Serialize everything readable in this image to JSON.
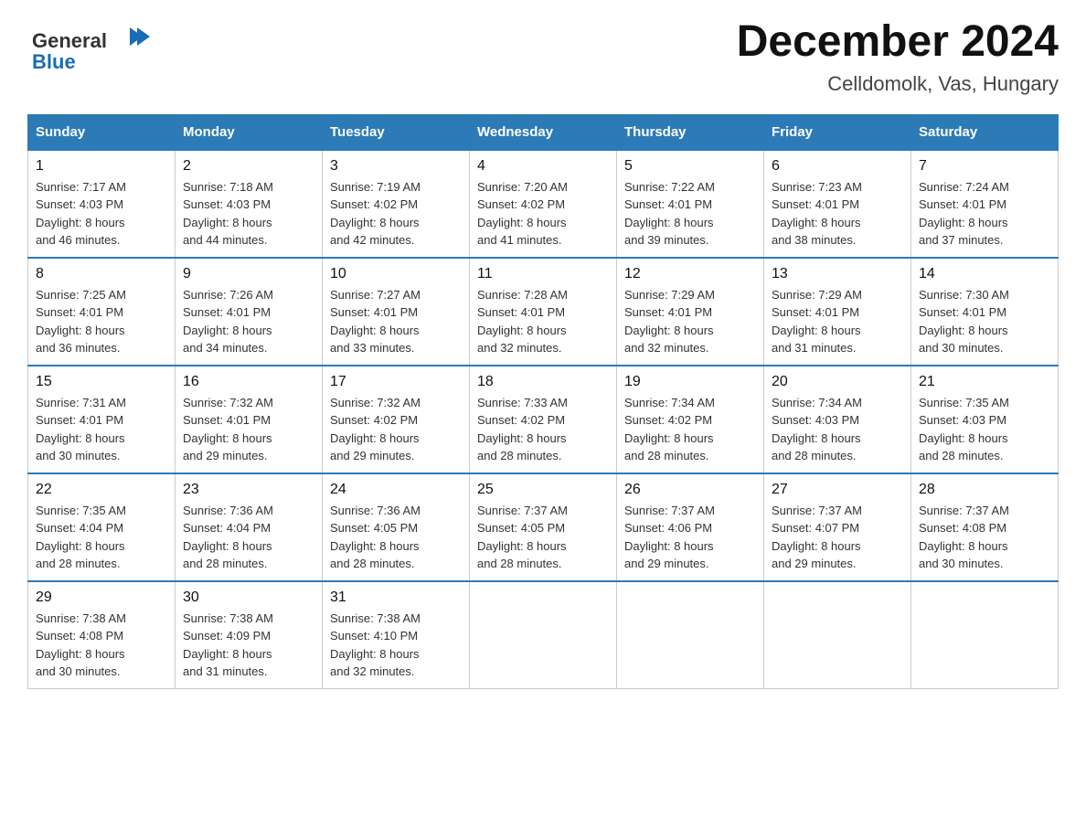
{
  "header": {
    "logo_alt": "General Blue",
    "month_year": "December 2024",
    "location": "Celldomolk, Vas, Hungary"
  },
  "days_of_week": [
    "Sunday",
    "Monday",
    "Tuesday",
    "Wednesday",
    "Thursday",
    "Friday",
    "Saturday"
  ],
  "weeks": [
    [
      {
        "day": "1",
        "sunrise": "7:17 AM",
        "sunset": "4:03 PM",
        "daylight": "8 hours and 46 minutes."
      },
      {
        "day": "2",
        "sunrise": "7:18 AM",
        "sunset": "4:03 PM",
        "daylight": "8 hours and 44 minutes."
      },
      {
        "day": "3",
        "sunrise": "7:19 AM",
        "sunset": "4:02 PM",
        "daylight": "8 hours and 42 minutes."
      },
      {
        "day": "4",
        "sunrise": "7:20 AM",
        "sunset": "4:02 PM",
        "daylight": "8 hours and 41 minutes."
      },
      {
        "day": "5",
        "sunrise": "7:22 AM",
        "sunset": "4:01 PM",
        "daylight": "8 hours and 39 minutes."
      },
      {
        "day": "6",
        "sunrise": "7:23 AM",
        "sunset": "4:01 PM",
        "daylight": "8 hours and 38 minutes."
      },
      {
        "day": "7",
        "sunrise": "7:24 AM",
        "sunset": "4:01 PM",
        "daylight": "8 hours and 37 minutes."
      }
    ],
    [
      {
        "day": "8",
        "sunrise": "7:25 AM",
        "sunset": "4:01 PM",
        "daylight": "8 hours and 36 minutes."
      },
      {
        "day": "9",
        "sunrise": "7:26 AM",
        "sunset": "4:01 PM",
        "daylight": "8 hours and 34 minutes."
      },
      {
        "day": "10",
        "sunrise": "7:27 AM",
        "sunset": "4:01 PM",
        "daylight": "8 hours and 33 minutes."
      },
      {
        "day": "11",
        "sunrise": "7:28 AM",
        "sunset": "4:01 PM",
        "daylight": "8 hours and 32 minutes."
      },
      {
        "day": "12",
        "sunrise": "7:29 AM",
        "sunset": "4:01 PM",
        "daylight": "8 hours and 32 minutes."
      },
      {
        "day": "13",
        "sunrise": "7:29 AM",
        "sunset": "4:01 PM",
        "daylight": "8 hours and 31 minutes."
      },
      {
        "day": "14",
        "sunrise": "7:30 AM",
        "sunset": "4:01 PM",
        "daylight": "8 hours and 30 minutes."
      }
    ],
    [
      {
        "day": "15",
        "sunrise": "7:31 AM",
        "sunset": "4:01 PM",
        "daylight": "8 hours and 30 minutes."
      },
      {
        "day": "16",
        "sunrise": "7:32 AM",
        "sunset": "4:01 PM",
        "daylight": "8 hours and 29 minutes."
      },
      {
        "day": "17",
        "sunrise": "7:32 AM",
        "sunset": "4:02 PM",
        "daylight": "8 hours and 29 minutes."
      },
      {
        "day": "18",
        "sunrise": "7:33 AM",
        "sunset": "4:02 PM",
        "daylight": "8 hours and 28 minutes."
      },
      {
        "day": "19",
        "sunrise": "7:34 AM",
        "sunset": "4:02 PM",
        "daylight": "8 hours and 28 minutes."
      },
      {
        "day": "20",
        "sunrise": "7:34 AM",
        "sunset": "4:03 PM",
        "daylight": "8 hours and 28 minutes."
      },
      {
        "day": "21",
        "sunrise": "7:35 AM",
        "sunset": "4:03 PM",
        "daylight": "8 hours and 28 minutes."
      }
    ],
    [
      {
        "day": "22",
        "sunrise": "7:35 AM",
        "sunset": "4:04 PM",
        "daylight": "8 hours and 28 minutes."
      },
      {
        "day": "23",
        "sunrise": "7:36 AM",
        "sunset": "4:04 PM",
        "daylight": "8 hours and 28 minutes."
      },
      {
        "day": "24",
        "sunrise": "7:36 AM",
        "sunset": "4:05 PM",
        "daylight": "8 hours and 28 minutes."
      },
      {
        "day": "25",
        "sunrise": "7:37 AM",
        "sunset": "4:05 PM",
        "daylight": "8 hours and 28 minutes."
      },
      {
        "day": "26",
        "sunrise": "7:37 AM",
        "sunset": "4:06 PM",
        "daylight": "8 hours and 29 minutes."
      },
      {
        "day": "27",
        "sunrise": "7:37 AM",
        "sunset": "4:07 PM",
        "daylight": "8 hours and 29 minutes."
      },
      {
        "day": "28",
        "sunrise": "7:37 AM",
        "sunset": "4:08 PM",
        "daylight": "8 hours and 30 minutes."
      }
    ],
    [
      {
        "day": "29",
        "sunrise": "7:38 AM",
        "sunset": "4:08 PM",
        "daylight": "8 hours and 30 minutes."
      },
      {
        "day": "30",
        "sunrise": "7:38 AM",
        "sunset": "4:09 PM",
        "daylight": "8 hours and 31 minutes."
      },
      {
        "day": "31",
        "sunrise": "7:38 AM",
        "sunset": "4:10 PM",
        "daylight": "8 hours and 32 minutes."
      },
      null,
      null,
      null,
      null
    ]
  ],
  "labels": {
    "sunrise": "Sunrise:",
    "sunset": "Sunset:",
    "daylight": "Daylight:"
  },
  "colors": {
    "header_bg": "#2c7bb6",
    "header_text": "#ffffff",
    "border": "#cccccc",
    "row_border_top": "#2c7bb6"
  }
}
